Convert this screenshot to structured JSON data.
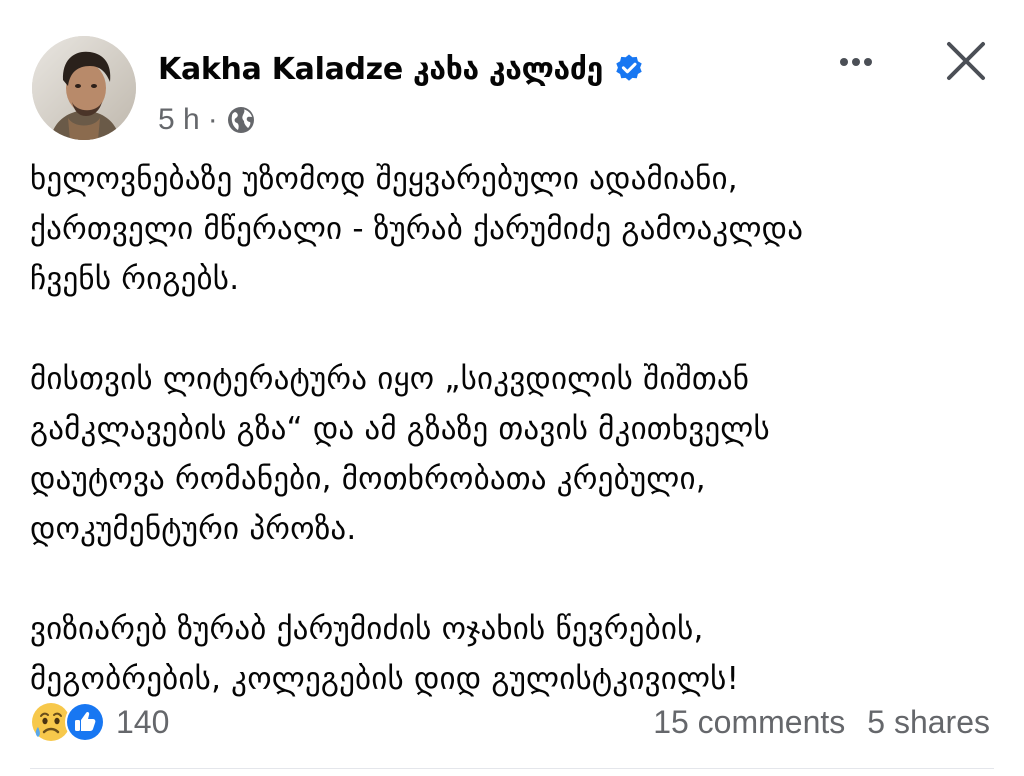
{
  "post": {
    "author": "Kakha Kaladze კახა კალაძე",
    "time": "5 h",
    "separator": "·",
    "verified_icon": "verified-badge-icon",
    "privacy_icon": "globe-icon",
    "body": [
      [
        "ხელოვნებაზე უზომოდ შეყვარებული ადამიანი,",
        "ქართველი მწერალი - ზურაბ ქარუმიძე გამოაკლდა",
        "ჩვენს რიგებს."
      ],
      [
        "მისთვის ლიტერატურა იყო „სიკვდილის შიშთან",
        "გამკლავების გზა“ და ამ გზაზე თავის მკითხველს",
        "დაუტოვა რომანები, მოთხრობათა კრებული,",
        "დოკუმენტური პროზა."
      ],
      [
        "ვიზიარებ ზურაბ ქარუმიძის ოჯახის წევრების,",
        "მეგობრების, კოლეგების დიდ გულისტკივილს!"
      ]
    ]
  },
  "footer": {
    "reaction_count": "140",
    "reaction_icons": [
      "sad-reaction-icon",
      "like-reaction-icon"
    ],
    "comments": "15 comments",
    "shares": "5 shares"
  },
  "colors": {
    "verified": "#1877f2",
    "like": "#1877f2",
    "sad_face": "#f7c84b",
    "muted_text": "#65676b",
    "body_text": "#050505"
  }
}
